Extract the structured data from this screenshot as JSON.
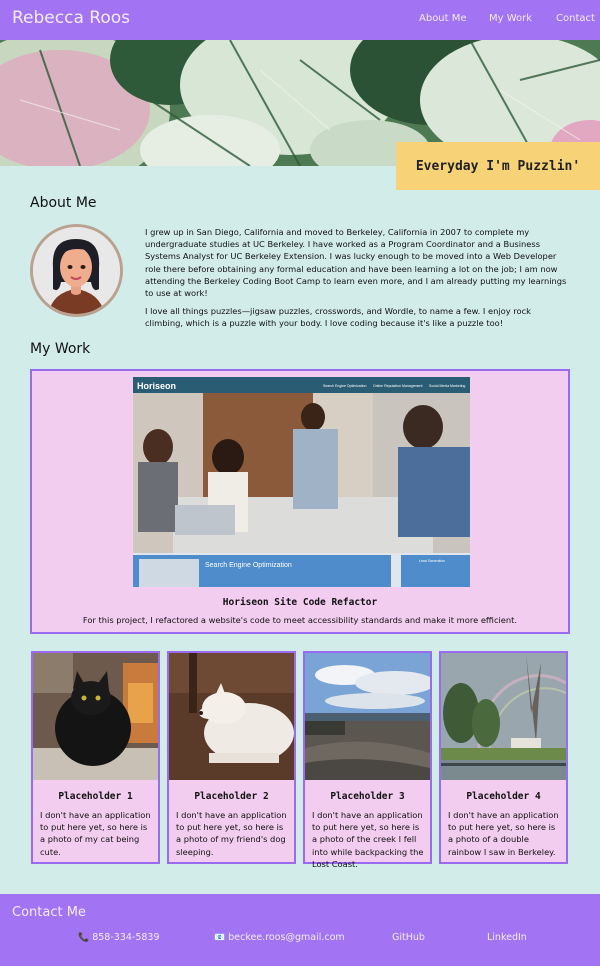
{
  "header": {
    "brand": "Rebecca Roos",
    "nav": [
      "About Me",
      "My Work",
      "Contact"
    ]
  },
  "hero": {
    "tagline": "Everyday I'm Puzzlin'"
  },
  "about": {
    "title": "About Me",
    "paragraphs": [
      "I grew up in San Diego, California and moved to Berkeley, California in 2007 to complete my undergraduate studies at UC Berkeley. I have worked as a Program Coordinator and a Business Systems Analyst for UC Berkeley Extension. I was lucky enough to be moved into a Web Developer role there before obtaining any formal education and have been learning a lot on the job; I am now attending the Berkeley Coding Boot Camp to learn even more, and I am already putting my learnings to use at work!",
      "I love all things puzzles—jigsaw puzzles, crosswords, and Wordle, to name a few. I enjoy rock climbing, which is a puzzle with your body. I love coding because it's like a puzzle too!"
    ]
  },
  "work": {
    "title": "My Work",
    "featured": {
      "title": "Horiseon Site Code Refactor",
      "description": "For this project, I refactored a website's code to meet accessibility standards and make it more efficient.",
      "screenshot": {
        "brand": "Horiseon",
        "nav": [
          "Search Engine Optimization",
          "Online Reputation Management",
          "Social Media Marketing"
        ],
        "panel_title": "Search Engine Optimization",
        "side_title": "Lead Generation"
      }
    },
    "placeholders": [
      {
        "title": "Placeholder 1",
        "description": "I don't have an application to put here yet, so here is a photo of my cat being cute."
      },
      {
        "title": "Placeholder 2",
        "description": "I don't have an application to put here yet, so here is a photo of my friend's dog sleeping."
      },
      {
        "title": "Placeholder 3",
        "description": "I don't have an application to put here yet, so here is a photo of the creek I fell into while backpacking the Lost Coast."
      },
      {
        "title": "Placeholder 4",
        "description": "I don't have an application to put here yet, so here is a photo of a double rainbow I saw in Berkeley."
      }
    ]
  },
  "footer": {
    "title": "Contact Me",
    "phone": "858-334-5839",
    "email": "beckee.roos@gmail.com",
    "github": "GitHub",
    "linkedin": "LinkedIn",
    "phone_icon": "phone-icon",
    "email_icon": "email-icon"
  },
  "colors": {
    "header": "#a273f3",
    "background": "#d2ecea",
    "card": "#f3cdef",
    "card_border": "#9a6af0",
    "tagline_bg": "#f8d277"
  }
}
